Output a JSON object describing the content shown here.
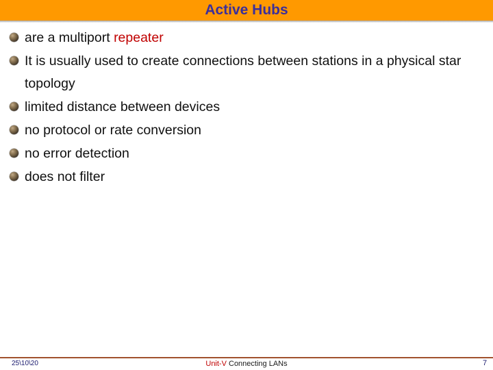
{
  "slide": {
    "title": "Active Hubs",
    "title_color": "#3B2F9B",
    "banner_color": "#FF9900",
    "accent_color": "#C00000",
    "rule_color": "#A0522D"
  },
  "bullets": [
    {
      "pre": "are a multiport ",
      "highlight": "repeater",
      "post": ""
    },
    {
      "pre": "It is usually used to create connections between stations in a physical star topology",
      "highlight": "",
      "post": ""
    },
    {
      "pre": "limited distance between devices",
      "highlight": "",
      "post": ""
    },
    {
      "pre": "no protocol or rate conversion",
      "highlight": "",
      "post": ""
    },
    {
      "pre": "no error detection",
      "highlight": "",
      "post": ""
    },
    {
      "pre": "does not filter",
      "highlight": "",
      "post": ""
    }
  ],
  "footer": {
    "date": "25\\10\\20",
    "unit": "Unit-V",
    "subject": "Connecting LANs",
    "page": "7"
  }
}
